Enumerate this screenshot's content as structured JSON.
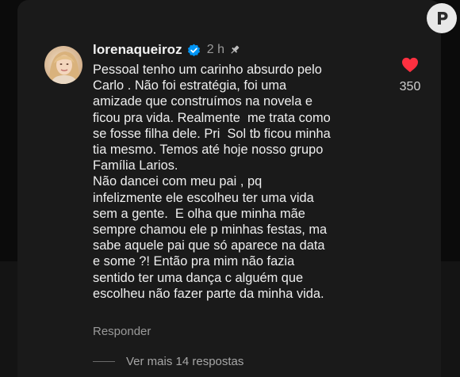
{
  "comment": {
    "username": "lorenaqueiroz",
    "time": "2 h",
    "text": "Pessoal tenho um carinho absurdo pelo\nCarlo . Não foi estratégia, foi uma\namizade que construímos na novela e\nficou pra vida. Realmente  me trata como\nse fosse filha dele. Pri  Sol tb ficou minha\ntia mesmo. Temos até hoje nosso grupo\nFamília Larios.\nNão dancei com meu pai , pq\ninfelizmente ele escolheu ter uma vida\nsem a gente.  E olha que minha mãe\nsempre chamou ele p minhas festas, ma\nsabe aquele pai que só aparece na data\ne some ?! Então pra mim não fazia\nsentido ter uma dança c alguém que\nescolheu não fazer parte da minha vida.",
    "reply_label": "Responder",
    "like_count": "350",
    "view_more": "Ver mais 14 respostas"
  },
  "colors": {
    "background": "#1a1a1a",
    "heart": "#ff3040",
    "verified": "#0095f6"
  },
  "icons": [
    "verified-icon",
    "pin-icon",
    "heart-icon",
    "avatar",
    "watermark-logo"
  ]
}
